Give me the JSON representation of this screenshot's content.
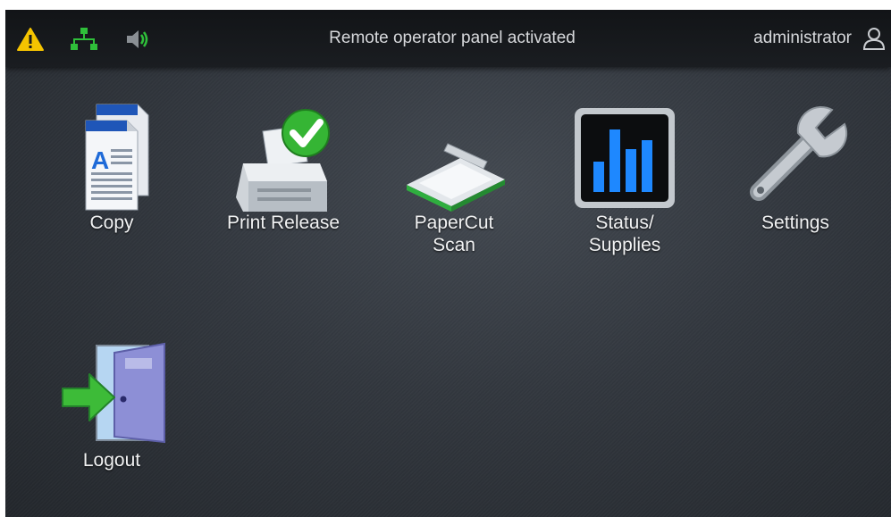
{
  "status_bar": {
    "icons": [
      "warning-icon",
      "network-icon",
      "speaker-icon"
    ],
    "message": "Remote operator panel activated",
    "user": "administrator",
    "user_icon": "user-icon"
  },
  "apps": [
    {
      "id": "copy",
      "icon": "copy-icon",
      "label_lines": [
        "Copy"
      ]
    },
    {
      "id": "print-release",
      "icon": "print-release-icon",
      "label_lines": [
        "Print Release"
      ]
    },
    {
      "id": "papercut-scan",
      "icon": "scanner-icon",
      "label_lines": [
        "PaperCut",
        "Scan"
      ]
    },
    {
      "id": "status-supplies",
      "icon": "status-chart-icon",
      "label_lines": [
        "Status/",
        "Supplies"
      ]
    },
    {
      "id": "settings",
      "icon": "wrench-icon",
      "label_lines": [
        "Settings"
      ]
    },
    {
      "id": "logout",
      "icon": "logout-door-icon",
      "label_lines": [
        "Logout"
      ]
    }
  ],
  "colors": {
    "warning": "#f5c400",
    "network": "#2fbf3a",
    "speaker": "#2fbf3a",
    "accent_blue": "#1e88ff"
  }
}
